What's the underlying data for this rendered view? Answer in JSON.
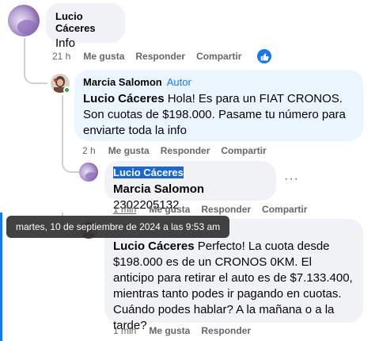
{
  "comments": [
    {
      "author": "Lucio Cáceres",
      "text": "Info",
      "time": "21 h",
      "like": "Me gusta",
      "reply": "Responder",
      "share": "Compartir",
      "reaction_icon": "thumbs-up-icon"
    },
    {
      "author": "Marcia Salomon",
      "role": "Autor",
      "mention": "Lucio Cáceres",
      "text": "Hola! Es para un FIAT CRONOS. Son cuotas de $198.000. Pasame tu número para enviarte toda la info",
      "time": "2 h",
      "like": "Me gusta",
      "reply": "Responder",
      "share": "Compartir"
    },
    {
      "author": "Lucio Cáceres",
      "mention": "Marcia Salomon",
      "text": "2302205132",
      "time": "1 min",
      "like": "Me gusta",
      "reply": "Responder",
      "share": "Compartir",
      "more": "···"
    },
    {
      "mention": "Lucio Cáceres",
      "text": "Perfecto! La cuota desde $198.000 es de un CRONOS 0KM. El anticipo para retirar el auto es de $7.133.400, mientras tanto podes ir pagando en cuotas. Cuándo podes hablar? A la mañana o a la tarde?",
      "time": "1 min",
      "like": "Me gusta",
      "reply": "Responder"
    }
  ],
  "tooltip": "martes, 10 de septiembre de 2024 a las 9:53 am",
  "colors": {
    "link_blue": "#1877f2",
    "bubble_gray": "#f0f2f5",
    "bubble_blue": "#ebf5ff",
    "selection": "#1967d2"
  }
}
